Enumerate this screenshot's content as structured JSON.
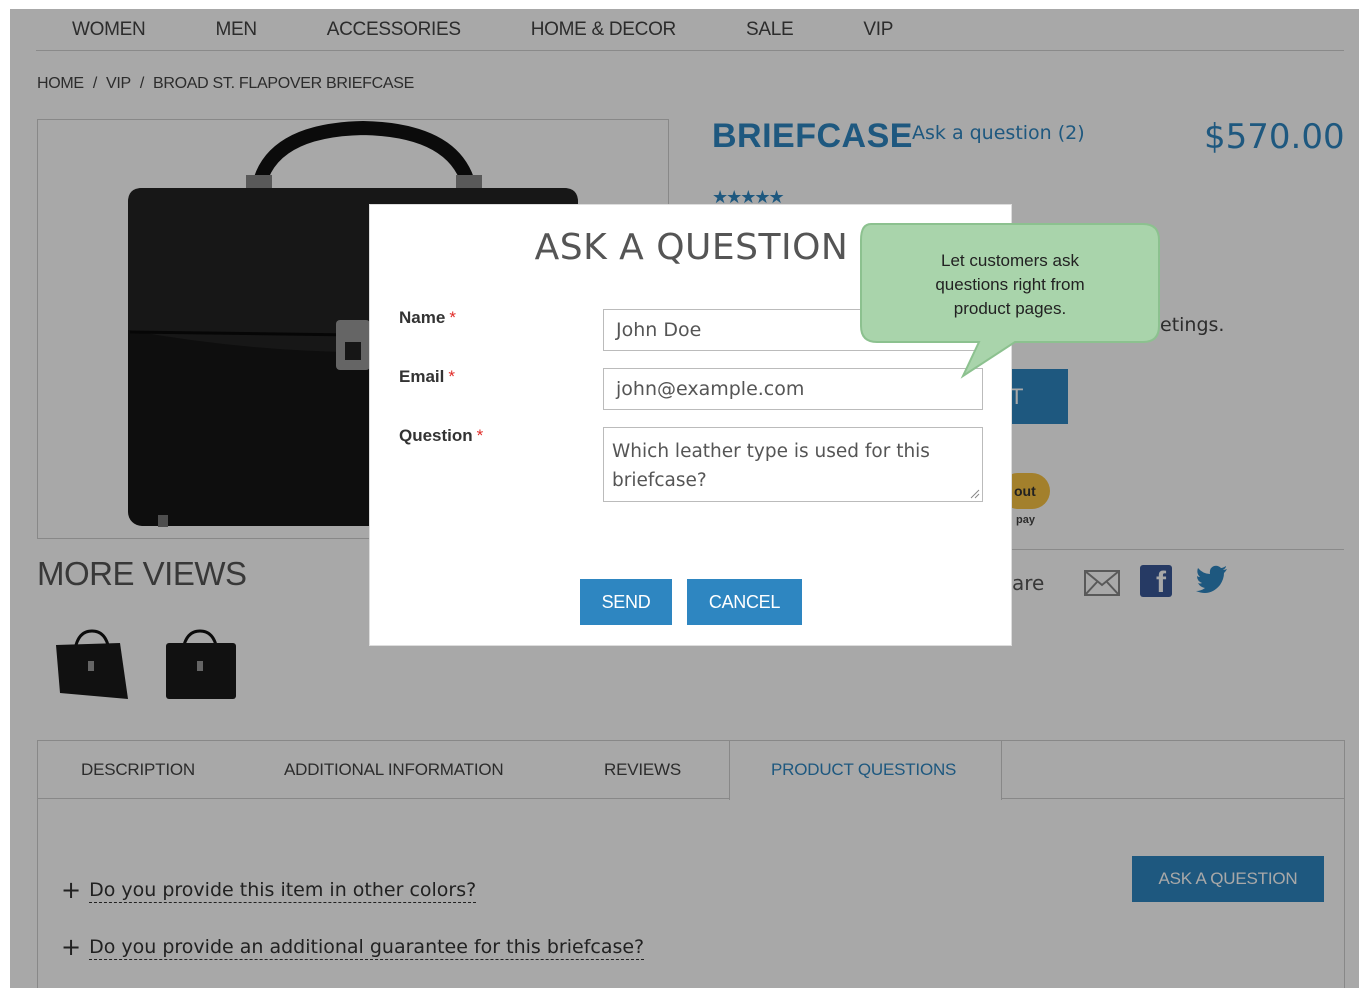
{
  "nav": {
    "items": [
      "WOMEN",
      "MEN",
      "ACCESSORIES",
      "HOME & DECOR",
      "SALE",
      "VIP"
    ]
  },
  "breadcrumb": {
    "home": "HOME",
    "vip": "VIP",
    "current": "BROAD ST. FLAPOVER BRIEFCASE",
    "separator": "/"
  },
  "product": {
    "title": "BRIEFCASE",
    "ask_link": "Ask a question (2)",
    "price": "$570.00",
    "rating_stars": "★★★★★",
    "partial_text": "etings.",
    "add_to_cart_partial": "T",
    "paypal_partial": "out",
    "paypal_sub_partial": "pay",
    "share_partial": "are"
  },
  "more_views": {
    "title": "MORE VIEWS"
  },
  "tabs": {
    "description": "DESCRIPTION",
    "additional": "ADDITIONAL INFORMATION",
    "reviews": "REVIEWS",
    "questions": "PRODUCT QUESTIONS",
    "ask_button": "ASK A QUESTION",
    "faq": [
      "Do you provide this item in other colors?",
      "Do you provide an additional guarantee for this briefcase?"
    ],
    "plus": "+"
  },
  "modal": {
    "title": "ASK A QUESTION",
    "name_label": "Name",
    "email_label": "Email",
    "question_label": "Question",
    "required_mark": "*",
    "name_value": "John Doe",
    "email_value": "john@example.com",
    "question_value": "Which leather type is used for this briefcase?",
    "send_label": "SEND",
    "cancel_label": "CANCEL"
  },
  "tooltip": {
    "line1": "Let customers ask",
    "line2": "questions right from",
    "line3": "product pages."
  },
  "colors": {
    "accent": "#2e86c1",
    "required": "#e02b27",
    "tooltip_bg": "#a8d5a8",
    "overlay": "rgba(0,0,0,0.34)"
  },
  "icons": [
    "envelope-icon",
    "facebook-icon",
    "twitter-icon",
    "star-icon"
  ]
}
